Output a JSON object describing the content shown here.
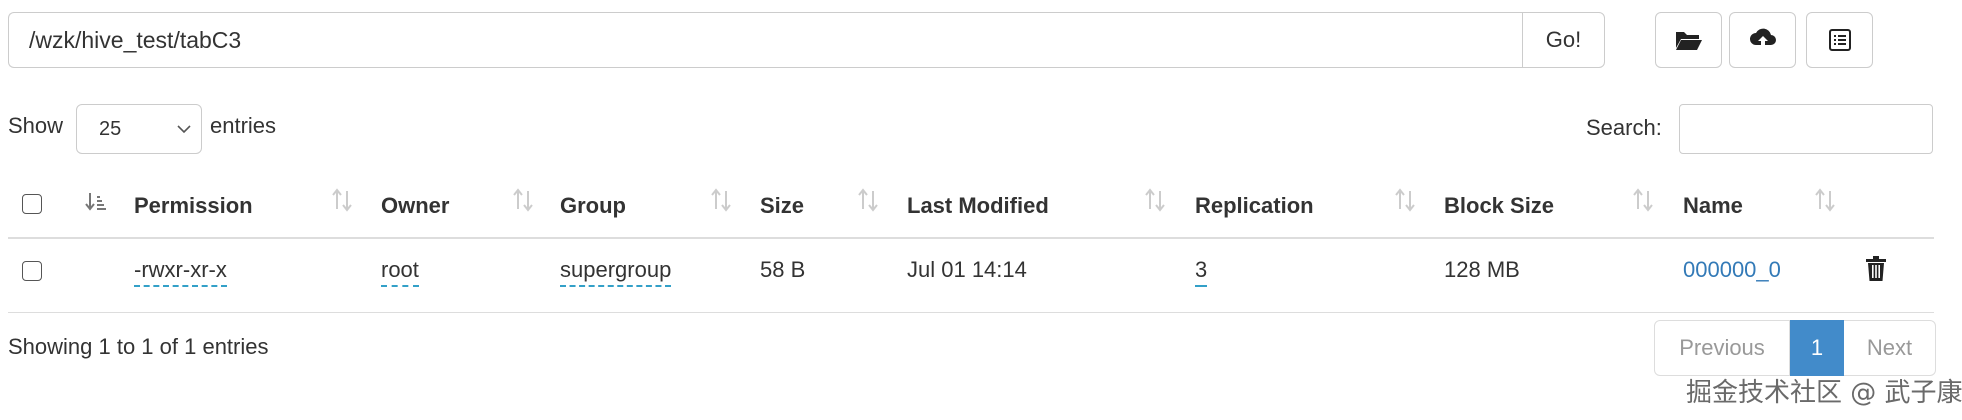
{
  "path_bar": {
    "path_value": "/wzk/hive_test/tabC3",
    "go_label": "Go!"
  },
  "toolbar": {
    "icons": [
      "open-folder-icon",
      "cloud-upload-icon",
      "list-icon"
    ]
  },
  "length_control": {
    "show_label": "Show",
    "selected": "25",
    "entries_label": "entries"
  },
  "search": {
    "label": "Search:",
    "value": ""
  },
  "table": {
    "columns": [
      "Permission",
      "Owner",
      "Group",
      "Size",
      "Last Modified",
      "Replication",
      "Block Size",
      "Name"
    ],
    "rows": [
      {
        "permission": "-rwxr-xr-x",
        "owner": "root",
        "group": "supergroup",
        "size": "58 B",
        "last_modified": "Jul 01 14:14",
        "replication": "3",
        "block_size": "128 MB",
        "name": "000000_0"
      }
    ]
  },
  "info": "Showing 1 to 1 of 1 entries",
  "pagination": {
    "previous": "Previous",
    "current": "1",
    "next": "Next"
  },
  "watermark": "掘金技术社区 @ 武子康",
  "colors": {
    "link": "#337ab7",
    "active_page": "#428bca",
    "dotted_underline": "#33a0c8"
  }
}
